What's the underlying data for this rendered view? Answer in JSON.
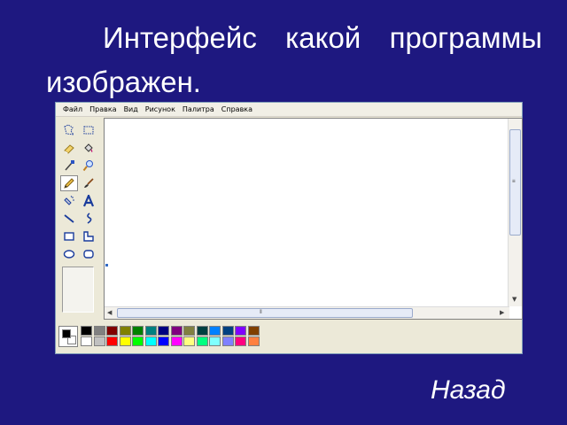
{
  "slide": {
    "title": "Интерфейс какой программы изображен.",
    "back_label": "Назад"
  },
  "menu": {
    "items": [
      "Файл",
      "Правка",
      "Вид",
      "Рисунок",
      "Палитра",
      "Справка"
    ]
  },
  "tools": [
    {
      "name": "free-select-icon"
    },
    {
      "name": "rect-select-icon"
    },
    {
      "name": "eraser-icon"
    },
    {
      "name": "fill-icon"
    },
    {
      "name": "color-picker-icon"
    },
    {
      "name": "magnifier-icon"
    },
    {
      "name": "pencil-icon",
      "active": true
    },
    {
      "name": "brush-icon"
    },
    {
      "name": "airbrush-icon"
    },
    {
      "name": "text-icon"
    },
    {
      "name": "line-icon"
    },
    {
      "name": "curve-icon"
    },
    {
      "name": "rectangle-icon"
    },
    {
      "name": "polygon-icon"
    },
    {
      "name": "ellipse-icon"
    },
    {
      "name": "rounded-rect-icon"
    }
  ],
  "colors": {
    "background": "#1e1880",
    "foreground_color": "#000000",
    "background_color": "#ffffff",
    "palette_row1": [
      "#000000",
      "#808080",
      "#800000",
      "#808000",
      "#008000",
      "#008080",
      "#000080",
      "#800080",
      "#808040",
      "#004040",
      "#0080ff",
      "#004080",
      "#8000ff",
      "#804000"
    ],
    "palette_row2": [
      "#ffffff",
      "#c0c0c0",
      "#ff0000",
      "#ffff00",
      "#00ff00",
      "#00ffff",
      "#0000ff",
      "#ff00ff",
      "#ffff80",
      "#00ff80",
      "#80ffff",
      "#8080ff",
      "#ff0080",
      "#ff8040"
    ]
  }
}
